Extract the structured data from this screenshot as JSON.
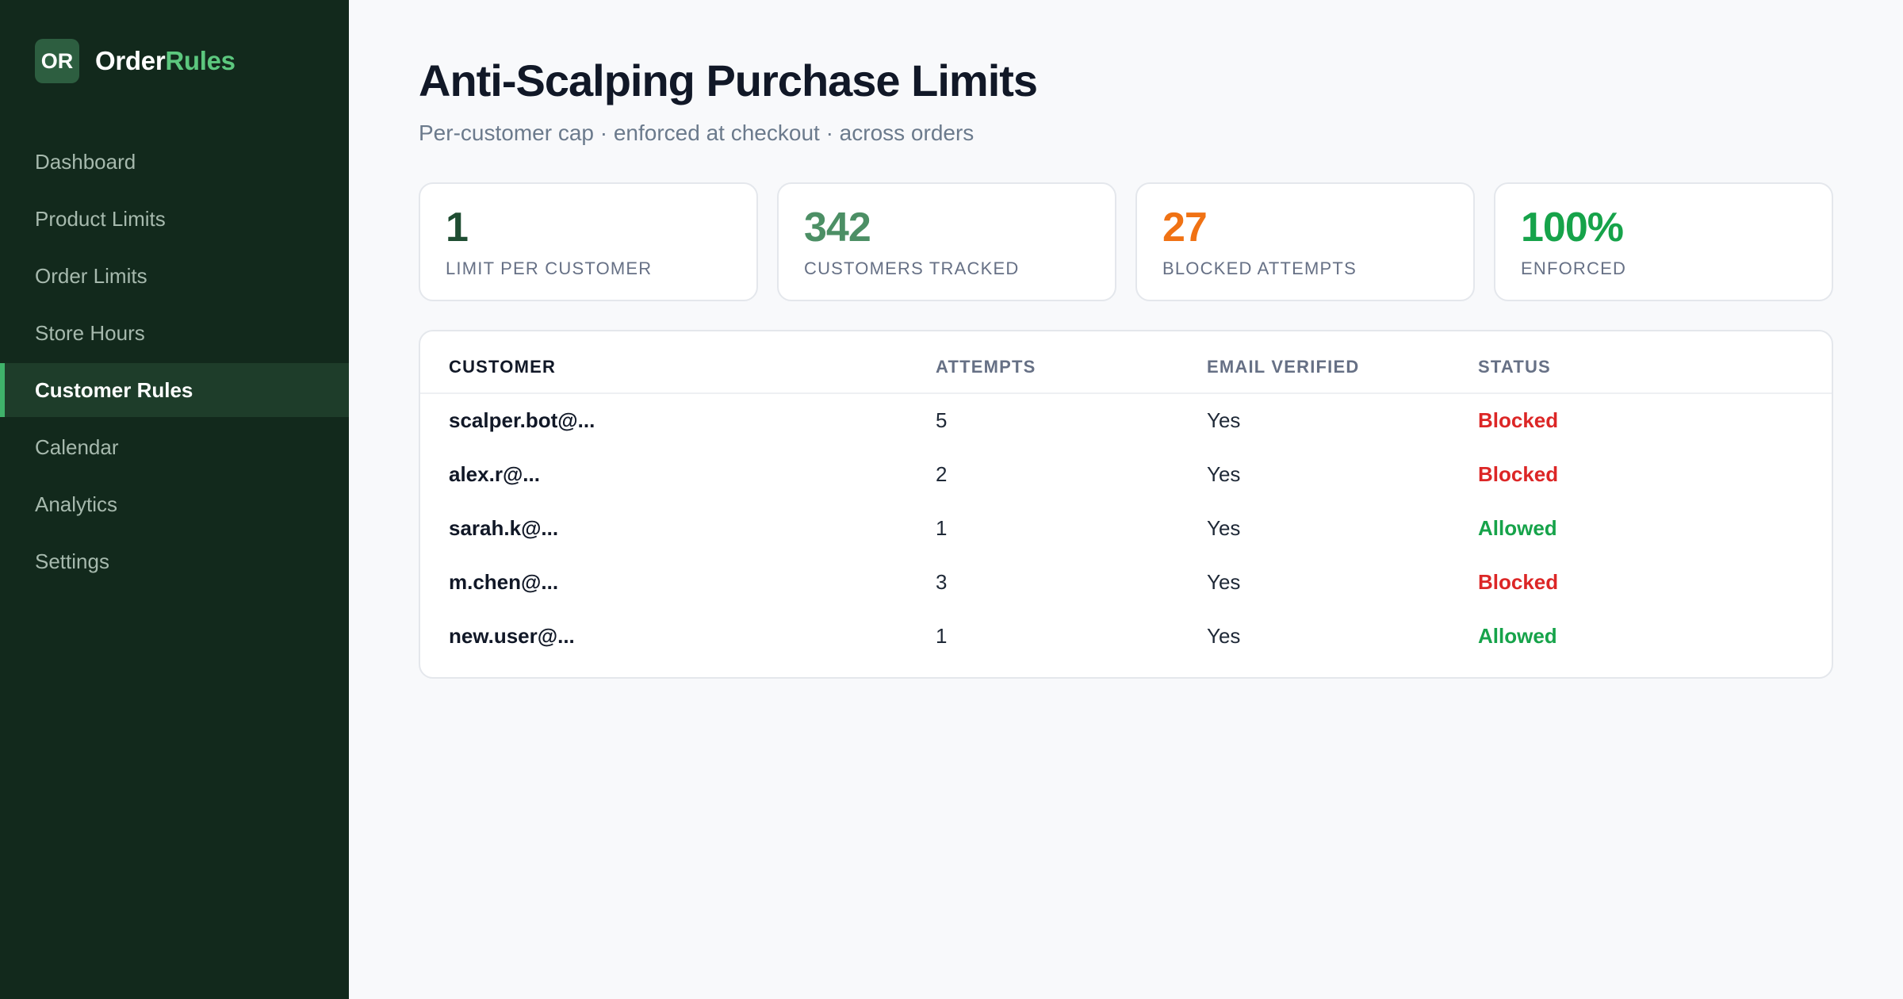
{
  "brand": {
    "logo_text": "OR",
    "name_part1": "Order",
    "name_part2": "Rules"
  },
  "sidebar": {
    "items": [
      {
        "label": "Dashboard",
        "active": false
      },
      {
        "label": "Product Limits",
        "active": false
      },
      {
        "label": "Order Limits",
        "active": false
      },
      {
        "label": "Store Hours",
        "active": false
      },
      {
        "label": "Customer Rules",
        "active": true
      },
      {
        "label": "Calendar",
        "active": false
      },
      {
        "label": "Analytics",
        "active": false
      },
      {
        "label": "Settings",
        "active": false
      }
    ]
  },
  "header": {
    "title": "Anti-Scalping Purchase Limits",
    "subtitle": "Per-customer cap · enforced at checkout · across orders"
  },
  "stats": [
    {
      "value": "1",
      "label": "LIMIT PER CUSTOMER",
      "color": "#1f4d32"
    },
    {
      "value": "342",
      "label": "CUSTOMERS TRACKED",
      "color": "#4c8f65"
    },
    {
      "value": "27",
      "label": "BLOCKED ATTEMPTS",
      "color": "#f07214"
    },
    {
      "value": "100%",
      "label": "ENFORCED",
      "color": "#16a34a"
    }
  ],
  "table": {
    "headers": [
      "CUSTOMER",
      "ATTEMPTS",
      "EMAIL VERIFIED",
      "STATUS"
    ],
    "rows": [
      {
        "customer": "scalper.bot@...",
        "attempts": "5",
        "email_verified": "Yes",
        "status": "Blocked"
      },
      {
        "customer": "alex.r@...",
        "attempts": "2",
        "email_verified": "Yes",
        "status": "Blocked"
      },
      {
        "customer": "sarah.k@...",
        "attempts": "1",
        "email_verified": "Yes",
        "status": "Allowed"
      },
      {
        "customer": "m.chen@...",
        "attempts": "3",
        "email_verified": "Yes",
        "status": "Blocked"
      },
      {
        "customer": "new.user@...",
        "attempts": "1",
        "email_verified": "Yes",
        "status": "Allowed"
      }
    ]
  },
  "colors": {
    "sidebar_bg": "#12291c",
    "accent": "#5cc77e",
    "blocked": "#dc2626",
    "allowed": "#16a34a"
  }
}
